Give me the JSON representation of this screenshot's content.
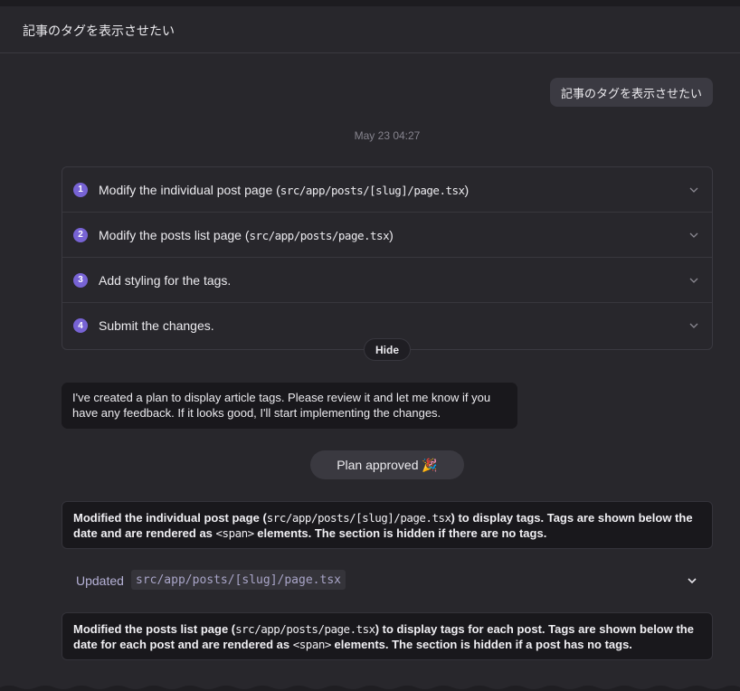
{
  "header": {
    "title": "記事のタグを表示させたい"
  },
  "user_message": {
    "text": "記事のタグを表示させたい"
  },
  "timestamp": "May 23 04:27",
  "plan": {
    "steps": [
      {
        "number": "1",
        "text_before": "Modify the individual post page (",
        "code": "src/app/posts/[slug]/page.tsx",
        "text_after": ")"
      },
      {
        "number": "2",
        "text_before": "Modify the posts list page (",
        "code": "src/app/posts/page.tsx",
        "text_after": ")"
      },
      {
        "number": "3",
        "text_before": "Add styling for the tags.",
        "code": "",
        "text_after": ""
      },
      {
        "number": "4",
        "text_before": "Submit the changes.",
        "code": "",
        "text_after": ""
      }
    ],
    "hide_label": "Hide"
  },
  "assistant_message": {
    "text": "I've created a plan to display article tags. Please review it and let me know if you have any feedback. If it looks good, I'll start implementing the changes."
  },
  "plan_approved": {
    "label": "Plan approved 🎉"
  },
  "card1": {
    "t1": "Modified the individual post page (",
    "code1": "src/app/posts/[slug]/page.tsx",
    "t2": ") to display tags. Tags are shown below the date and are rendered as ",
    "code2": "<span>",
    "t3": " elements. The section is hidden if there are no tags."
  },
  "updated": {
    "label": "Updated",
    "path": "src/app/posts/[slug]/page.tsx"
  },
  "card2": {
    "t1": "Modified the posts list page (",
    "code1": "src/app/posts/page.tsx",
    "t2": ") to display tags for each post. Tags are shown below the date for each post and are rendered as ",
    "code2": "<span>",
    "t3": " elements. The section is hidden if a post has no tags."
  },
  "colors": {
    "accent": "#7763d4",
    "background": "#28272c",
    "bubble": "#19181c"
  },
  "icons": {
    "step_chevron": "chevron-down-icon",
    "updated_chevron": "chevron-down-icon"
  }
}
